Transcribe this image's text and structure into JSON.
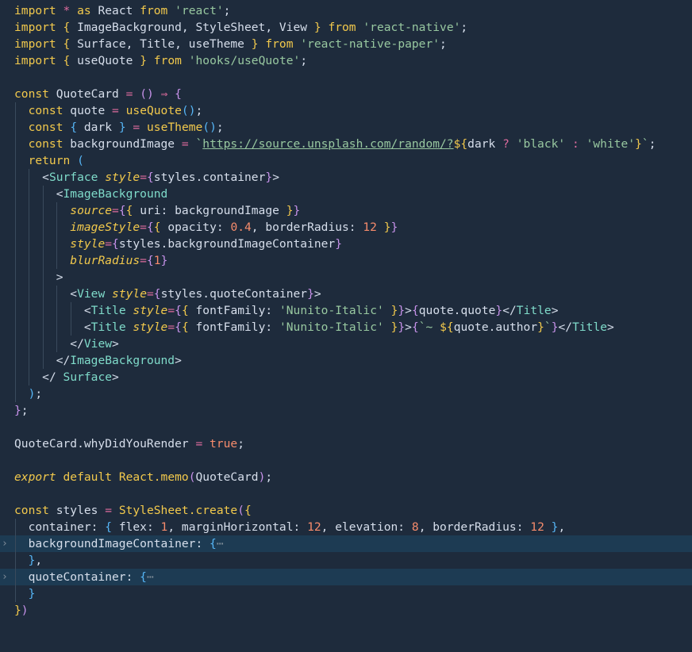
{
  "editor": {
    "language": "javascript-react",
    "colors": {
      "background": "#1e2b3c",
      "highlight": "#1d3b53",
      "keyword": "#f2c94c",
      "string": "#98c8a0",
      "operator": "#e06c9f",
      "number": "#f78c6c",
      "tag": "#7fdbca",
      "bracket": "#c792ea"
    },
    "folded_ellipsis": "⋯",
    "fold_icon": "chevron-right-icon"
  }
}
